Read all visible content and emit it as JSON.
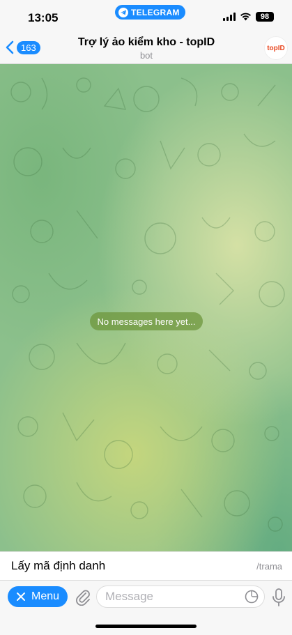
{
  "status_bar": {
    "time": "13:05",
    "app_pill": "TELEGRAM",
    "battery": "98"
  },
  "header": {
    "back_count": "163",
    "title": "Trợ lý ảo kiểm kho - topID",
    "subtitle": "bot",
    "avatar_text": "topID"
  },
  "chat": {
    "empty_text": "No messages here yet..."
  },
  "command_suggestion": {
    "label": "Lấy mã định danh",
    "command": "/trama"
  },
  "input_bar": {
    "menu_label": "Menu",
    "placeholder": "Message"
  },
  "colors": {
    "accent": "#1a8cff",
    "wallpaper_green": "#8cc08c",
    "wallpaper_yellow": "#d8e2a6"
  }
}
